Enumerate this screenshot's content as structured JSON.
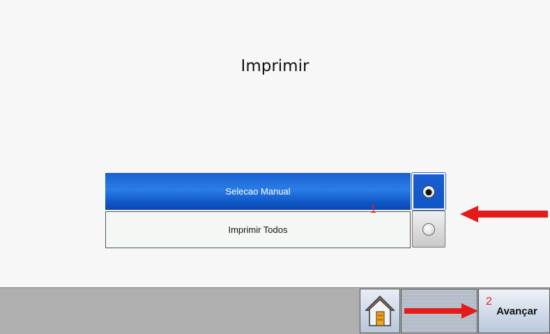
{
  "screen": {
    "title": "Imprimir"
  },
  "options": [
    {
      "label": "Selecao Manual",
      "selected": true
    },
    {
      "label": "Imprimir Todos",
      "selected": false
    }
  ],
  "annotations": {
    "marker_1": "1",
    "marker_2": "2",
    "arrow_color": "#e31b1b"
  },
  "footer": {
    "home_icon": "home-icon",
    "next_label": "Avançar"
  }
}
